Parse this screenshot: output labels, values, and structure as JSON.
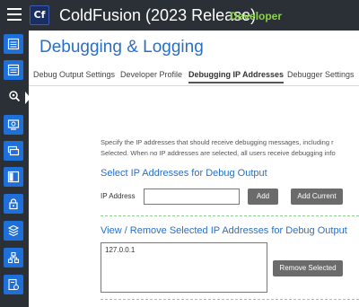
{
  "header": {
    "logo_text": "Cf",
    "title": "ColdFusion (2023 Release)",
    "edition": "Developer"
  },
  "sidebar": {
    "items": [
      {
        "icon": "server-settings-icon"
      },
      {
        "icon": "data-services-icon"
      },
      {
        "icon": "debugging-search-icon",
        "active": true
      },
      {
        "icon": "server-monitoring-icon"
      },
      {
        "icon": "event-gateways-icon"
      },
      {
        "icon": "extensions-icon"
      },
      {
        "icon": "security-lock-icon"
      },
      {
        "icon": "packages-icon"
      },
      {
        "icon": "cluster-icon"
      },
      {
        "icon": "package-deploy-icon"
      }
    ]
  },
  "page": {
    "title": "Debugging & Logging",
    "tabs": [
      {
        "label": "Debug Output Settings"
      },
      {
        "label": "Developer Profile"
      },
      {
        "label": "Debugging IP Addresses",
        "active": true
      },
      {
        "label": "Debugger Settings"
      }
    ],
    "description_line1": "Specify the IP addresses that should receive debugging messages, including r",
    "description_line2": "Selected. When no IP addresses are selected, all users receive debugging info",
    "select_section_title": "Select IP Addresses for Debug Output",
    "ip_address_label": "IP Address",
    "ip_address_value": "",
    "add_button": "Add",
    "add_current_button": "Add Current",
    "view_section_title": "View / Remove Selected IP Addresses for Debug Output",
    "ip_list": [
      "127.0.0.1"
    ],
    "remove_button": "Remove Selected"
  },
  "colors": {
    "header_bg": "#2b3036",
    "rail_button": "#1e6fd8",
    "title_blue": "#2a6fc4",
    "edition_green": "#8bd14a",
    "button_gray": "#6b6b6b"
  }
}
